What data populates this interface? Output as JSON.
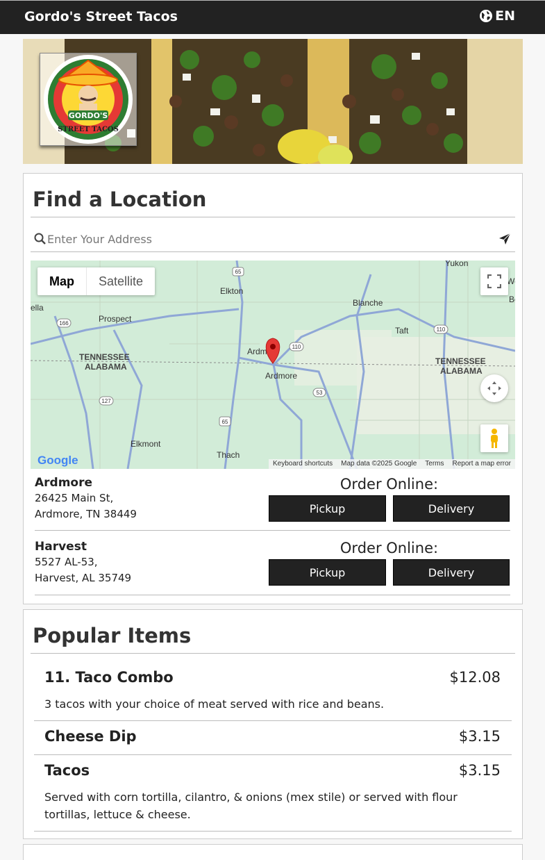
{
  "header": {
    "brand": "Gordo's Street Tacos",
    "lang": "EN"
  },
  "banner": {
    "logo_top": "GORDO'S",
    "logo_bottom": "STREET TACOS"
  },
  "find_location": {
    "title": "Find a Location",
    "search_placeholder": "Enter Your Address",
    "map": {
      "toggle": [
        "Map",
        "Satellite"
      ],
      "labels": [
        "Yukon",
        "Elkton",
        "Prospect",
        "Blanche",
        "Taft",
        "TENNESSEE",
        "ALABAMA",
        "TENNESSEE",
        "ALABAMA",
        "Ardmore",
        "Ardm",
        "Elkmont",
        "Thach",
        "ella",
        "We",
        "Be"
      ],
      "route_labels": [
        "65",
        "166",
        "110",
        "110",
        "127",
        "53",
        "65"
      ],
      "footer": [
        "Keyboard shortcuts",
        "Map data ©2025 Google",
        "Terms",
        "Report a map error"
      ],
      "google": "Google"
    },
    "order_title": "Order Online:",
    "locations": [
      {
        "name": "Ardmore",
        "addr1": "26425 Main St,",
        "addr2": "Ardmore, TN 38449",
        "pickup": "Pickup",
        "delivery": "Delivery"
      },
      {
        "name": "Harvest",
        "addr1": "5527 AL-53,",
        "addr2": "Harvest, AL 35749",
        "pickup": "Pickup",
        "delivery": "Delivery"
      }
    ]
  },
  "popular": {
    "title": "Popular Items",
    "items": [
      {
        "name": "11. Taco Combo",
        "price": "$12.08",
        "desc": "3 tacos with your choice of meat served with rice and beans."
      },
      {
        "name": "Cheese Dip",
        "price": "$3.15",
        "desc": ""
      },
      {
        "name": "Tacos",
        "price": "$3.15",
        "desc": "Served with corn tortilla, cilantro, & onions (mex stile) or served with flour tortillas, lettuce & cheese."
      }
    ]
  },
  "colors": {
    "header_bg": "#222222",
    "button_bg": "#222222",
    "map_pin": "#e53935"
  }
}
